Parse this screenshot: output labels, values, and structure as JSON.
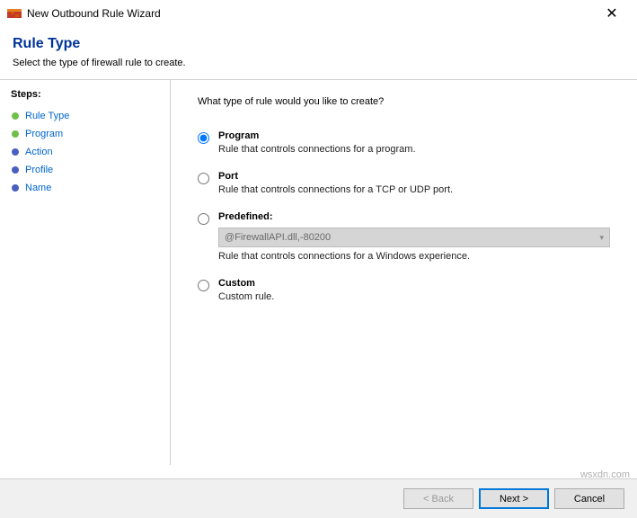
{
  "window": {
    "title": "New Outbound Rule Wizard"
  },
  "header": {
    "title": "Rule Type",
    "subtitle": "Select the type of firewall rule to create."
  },
  "sidebar": {
    "heading": "Steps:",
    "items": [
      {
        "label": "Rule Type"
      },
      {
        "label": "Program"
      },
      {
        "label": "Action"
      },
      {
        "label": "Profile"
      },
      {
        "label": "Name"
      }
    ]
  },
  "main": {
    "question": "What type of rule would you like to create?",
    "options": {
      "program": {
        "title": "Program",
        "desc": "Rule that controls connections for a program."
      },
      "port": {
        "title": "Port",
        "desc": "Rule that controls connections for a TCP or UDP port."
      },
      "predefined": {
        "title": "Predefined:",
        "select_value": "@FirewallAPI.dll,-80200",
        "desc": "Rule that controls connections for a Windows experience."
      },
      "custom": {
        "title": "Custom",
        "desc": "Custom rule."
      }
    }
  },
  "footer": {
    "back": "< Back",
    "next": "Next >",
    "cancel": "Cancel"
  },
  "watermark": "wsxdn.com"
}
